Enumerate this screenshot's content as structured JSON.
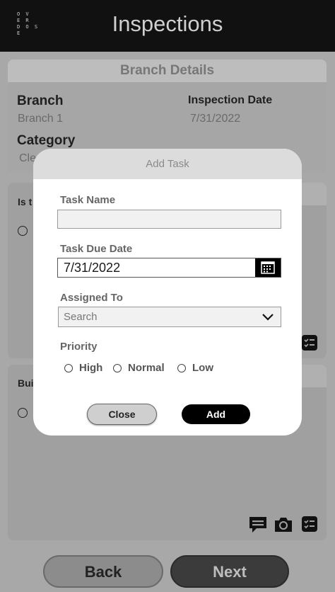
{
  "header": {
    "logo_lines": [
      "O V",
      "E R",
      "D O S E"
    ],
    "title": "Inspections"
  },
  "branch_details": {
    "heading": "Branch Details",
    "branch_label": "Branch",
    "branch_value": "Branch 1",
    "inspection_date_label": "Inspection Date",
    "inspection_date_value": "7/31/2022",
    "category_label": "Category",
    "category_value": "Cle"
  },
  "questions": [
    {
      "text": "Is t"
    },
    {
      "text": "Bui"
    }
  ],
  "footer": {
    "back_label": "Back",
    "next_label": "Next"
  },
  "modal": {
    "title": "Add Task",
    "task_name_label": "Task Name",
    "task_name_value": "",
    "due_date_label": "Task Due Date",
    "due_date_value": "7/31/2022",
    "assigned_label": "Assigned To",
    "assigned_placeholder": "Search",
    "priority_label": "Priority",
    "priority_options": [
      "High",
      "Normal",
      "Low"
    ],
    "close_label": "Close",
    "add_label": "Add"
  }
}
